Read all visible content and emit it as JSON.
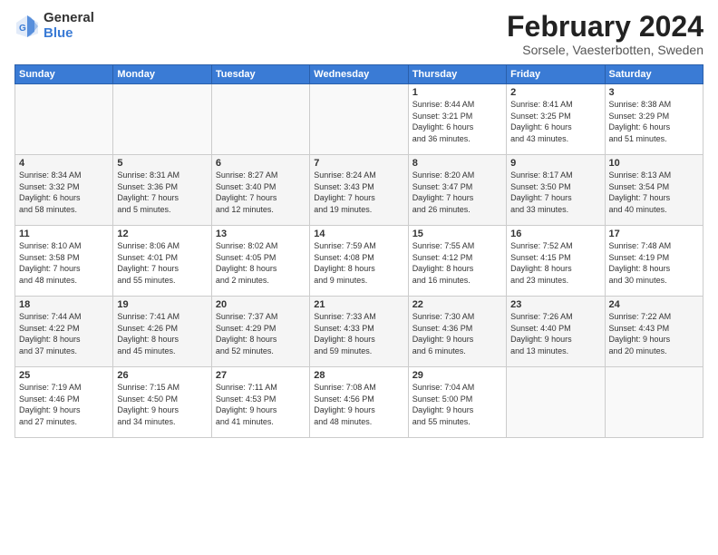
{
  "header": {
    "logo_general": "General",
    "logo_blue": "Blue",
    "title": "February 2024",
    "subtitle": "Sorsele, Vaesterbotten, Sweden"
  },
  "weekdays": [
    "Sunday",
    "Monday",
    "Tuesday",
    "Wednesday",
    "Thursday",
    "Friday",
    "Saturday"
  ],
  "weeks": [
    [
      {
        "day": "",
        "info": ""
      },
      {
        "day": "",
        "info": ""
      },
      {
        "day": "",
        "info": ""
      },
      {
        "day": "",
        "info": ""
      },
      {
        "day": "1",
        "info": "Sunrise: 8:44 AM\nSunset: 3:21 PM\nDaylight: 6 hours\nand 36 minutes."
      },
      {
        "day": "2",
        "info": "Sunrise: 8:41 AM\nSunset: 3:25 PM\nDaylight: 6 hours\nand 43 minutes."
      },
      {
        "day": "3",
        "info": "Sunrise: 8:38 AM\nSunset: 3:29 PM\nDaylight: 6 hours\nand 51 minutes."
      }
    ],
    [
      {
        "day": "4",
        "info": "Sunrise: 8:34 AM\nSunset: 3:32 PM\nDaylight: 6 hours\nand 58 minutes."
      },
      {
        "day": "5",
        "info": "Sunrise: 8:31 AM\nSunset: 3:36 PM\nDaylight: 7 hours\nand 5 minutes."
      },
      {
        "day": "6",
        "info": "Sunrise: 8:27 AM\nSunset: 3:40 PM\nDaylight: 7 hours\nand 12 minutes."
      },
      {
        "day": "7",
        "info": "Sunrise: 8:24 AM\nSunset: 3:43 PM\nDaylight: 7 hours\nand 19 minutes."
      },
      {
        "day": "8",
        "info": "Sunrise: 8:20 AM\nSunset: 3:47 PM\nDaylight: 7 hours\nand 26 minutes."
      },
      {
        "day": "9",
        "info": "Sunrise: 8:17 AM\nSunset: 3:50 PM\nDaylight: 7 hours\nand 33 minutes."
      },
      {
        "day": "10",
        "info": "Sunrise: 8:13 AM\nSunset: 3:54 PM\nDaylight: 7 hours\nand 40 minutes."
      }
    ],
    [
      {
        "day": "11",
        "info": "Sunrise: 8:10 AM\nSunset: 3:58 PM\nDaylight: 7 hours\nand 48 minutes."
      },
      {
        "day": "12",
        "info": "Sunrise: 8:06 AM\nSunset: 4:01 PM\nDaylight: 7 hours\nand 55 minutes."
      },
      {
        "day": "13",
        "info": "Sunrise: 8:02 AM\nSunset: 4:05 PM\nDaylight: 8 hours\nand 2 minutes."
      },
      {
        "day": "14",
        "info": "Sunrise: 7:59 AM\nSunset: 4:08 PM\nDaylight: 8 hours\nand 9 minutes."
      },
      {
        "day": "15",
        "info": "Sunrise: 7:55 AM\nSunset: 4:12 PM\nDaylight: 8 hours\nand 16 minutes."
      },
      {
        "day": "16",
        "info": "Sunrise: 7:52 AM\nSunset: 4:15 PM\nDaylight: 8 hours\nand 23 minutes."
      },
      {
        "day": "17",
        "info": "Sunrise: 7:48 AM\nSunset: 4:19 PM\nDaylight: 8 hours\nand 30 minutes."
      }
    ],
    [
      {
        "day": "18",
        "info": "Sunrise: 7:44 AM\nSunset: 4:22 PM\nDaylight: 8 hours\nand 37 minutes."
      },
      {
        "day": "19",
        "info": "Sunrise: 7:41 AM\nSunset: 4:26 PM\nDaylight: 8 hours\nand 45 minutes."
      },
      {
        "day": "20",
        "info": "Sunrise: 7:37 AM\nSunset: 4:29 PM\nDaylight: 8 hours\nand 52 minutes."
      },
      {
        "day": "21",
        "info": "Sunrise: 7:33 AM\nSunset: 4:33 PM\nDaylight: 8 hours\nand 59 minutes."
      },
      {
        "day": "22",
        "info": "Sunrise: 7:30 AM\nSunset: 4:36 PM\nDaylight: 9 hours\nand 6 minutes."
      },
      {
        "day": "23",
        "info": "Sunrise: 7:26 AM\nSunset: 4:40 PM\nDaylight: 9 hours\nand 13 minutes."
      },
      {
        "day": "24",
        "info": "Sunrise: 7:22 AM\nSunset: 4:43 PM\nDaylight: 9 hours\nand 20 minutes."
      }
    ],
    [
      {
        "day": "25",
        "info": "Sunrise: 7:19 AM\nSunset: 4:46 PM\nDaylight: 9 hours\nand 27 minutes."
      },
      {
        "day": "26",
        "info": "Sunrise: 7:15 AM\nSunset: 4:50 PM\nDaylight: 9 hours\nand 34 minutes."
      },
      {
        "day": "27",
        "info": "Sunrise: 7:11 AM\nSunset: 4:53 PM\nDaylight: 9 hours\nand 41 minutes."
      },
      {
        "day": "28",
        "info": "Sunrise: 7:08 AM\nSunset: 4:56 PM\nDaylight: 9 hours\nand 48 minutes."
      },
      {
        "day": "29",
        "info": "Sunrise: 7:04 AM\nSunset: 5:00 PM\nDaylight: 9 hours\nand 55 minutes."
      },
      {
        "day": "",
        "info": ""
      },
      {
        "day": "",
        "info": ""
      }
    ]
  ]
}
